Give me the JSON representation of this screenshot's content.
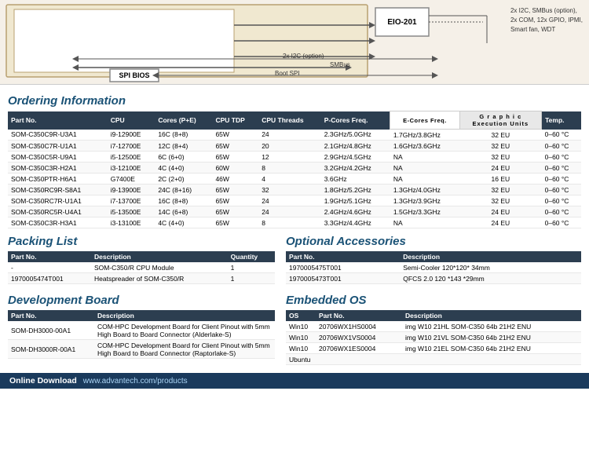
{
  "diagram": {
    "eio_label": "EIO-201",
    "spi_bios_label": "SPI BIOS",
    "right_labels_line1": "2x I2C, SMBus (option),",
    "right_labels_line2": "2x COM, 12x GPIO, IPMI,",
    "right_labels_line3": "Smart fan, WDT",
    "bus_2xi2c": "2x I2C (option)",
    "bus_smbus": "SMBus",
    "bus_bootspi": "Boot SPI"
  },
  "ordering": {
    "heading": "Ordering Information",
    "columns": [
      "Part No.",
      "CPU",
      "Cores (P+E)",
      "CPU TDP",
      "CPU Threads",
      "P-Cores Freq.",
      "E-Cores Freq.",
      "Graphic Execution Units",
      "Temp."
    ],
    "rows": [
      [
        "SOM-C350C9R-U3A1",
        "i9-12900E",
        "16C (8+8)",
        "65W",
        "24",
        "2.3GHz/5.0GHz",
        "1.7GHz/3.8GHz",
        "32 EU",
        "0–60 °C"
      ],
      [
        "SOM-C350C7R-U1A1",
        "i7-12700E",
        "12C (8+4)",
        "65W",
        "20",
        "2.1GHz/4.8GHz",
        "1.6GHz/3.6GHz",
        "32 EU",
        "0–60 °C"
      ],
      [
        "SOM-C350C5R-U9A1",
        "i5-12500E",
        "6C (6+0)",
        "65W",
        "12",
        "2.9GHz/4.5GHz",
        "NA",
        "32 EU",
        "0–60 °C"
      ],
      [
        "SOM-C350C3R-H2A1",
        "i3-12100E",
        "4C (4+0)",
        "60W",
        "8",
        "3.2GHz/4.2GHz",
        "NA",
        "24 EU",
        "0–60 °C"
      ],
      [
        "SOM-C350PTR-H6A1",
        "G7400E",
        "2C (2+0)",
        "46W",
        "4",
        "3.6GHz",
        "NA",
        "16 EU",
        "0–60 °C"
      ],
      [
        "SOM-C350RC9R-S8A1",
        "i9-13900E",
        "24C (8+16)",
        "65W",
        "32",
        "1.8GHz/5.2GHz",
        "1.3GHz/4.0GHz",
        "32 EU",
        "0–60 °C"
      ],
      [
        "SOM-C350RC7R-U1A1",
        "i7-13700E",
        "16C (8+8)",
        "65W",
        "24",
        "1.9GHz/5.1GHz",
        "1.3GHz/3.9GHz",
        "32 EU",
        "0–60 °C"
      ],
      [
        "SOM-C350RC5R-U4A1",
        "i5-13500E",
        "14C (6+8)",
        "65W",
        "24",
        "2.4GHz/4.6GHz",
        "1.5GHz/3.3GHz",
        "24 EU",
        "0–60 °C"
      ],
      [
        "SOM-C350C3R-H3A1",
        "i3-13100E",
        "4C (4+0)",
        "65W",
        "8",
        "3.3GHz/4.4GHz",
        "NA",
        "24 EU",
        "0–60 °C"
      ]
    ]
  },
  "packing": {
    "heading": "Packing List",
    "columns": [
      "Part No.",
      "Description",
      "Quantity"
    ],
    "rows": [
      [
        "-",
        "SOM-C350/R CPU Module",
        "1"
      ],
      [
        "1970005474T001",
        "Heatspreader of SOM-C350/R",
        "1"
      ]
    ]
  },
  "optional": {
    "heading": "Optional Accessories",
    "columns": [
      "Part No.",
      "Description"
    ],
    "rows": [
      [
        "1970005475T001",
        "Semi-Cooler 120*120* 34mm"
      ],
      [
        "1970005473T001",
        "QFCS 2.0 120 *143 *29mm"
      ]
    ]
  },
  "dev_board": {
    "heading": "Development Board",
    "columns": [
      "Part No.",
      "Description"
    ],
    "rows": [
      [
        "SOM-DH3000-00A1",
        "COM-HPC Development Board for Client Pinout with 5mm High Board to Board Connector (Alderlake-S)"
      ],
      [
        "SOM-DH3000R-00A1",
        "COM-HPC Development Board for Client Pinout with 5mm High Board to Board Connector (Raptorlake-S)"
      ]
    ]
  },
  "embedded_os": {
    "heading": "Embedded OS",
    "columns": [
      "OS",
      "Part No.",
      "Description"
    ],
    "rows": [
      [
        "Win10",
        "20706WX1HS0004",
        "img W10 21HL SOM-C350 64b 21H2 ENU"
      ],
      [
        "Win10",
        "20706WX1VS0004",
        "img W10 21VL SOM-C350 64b 21H2 ENU"
      ],
      [
        "Win10",
        "20706WX1ES0004",
        "img W10 21EL SOM-C350 64b 21H2 ENU"
      ],
      [
        "Ubuntu",
        "",
        ""
      ]
    ]
  },
  "footer": {
    "label": "Online Download",
    "url": "www.advantech.com/products"
  }
}
